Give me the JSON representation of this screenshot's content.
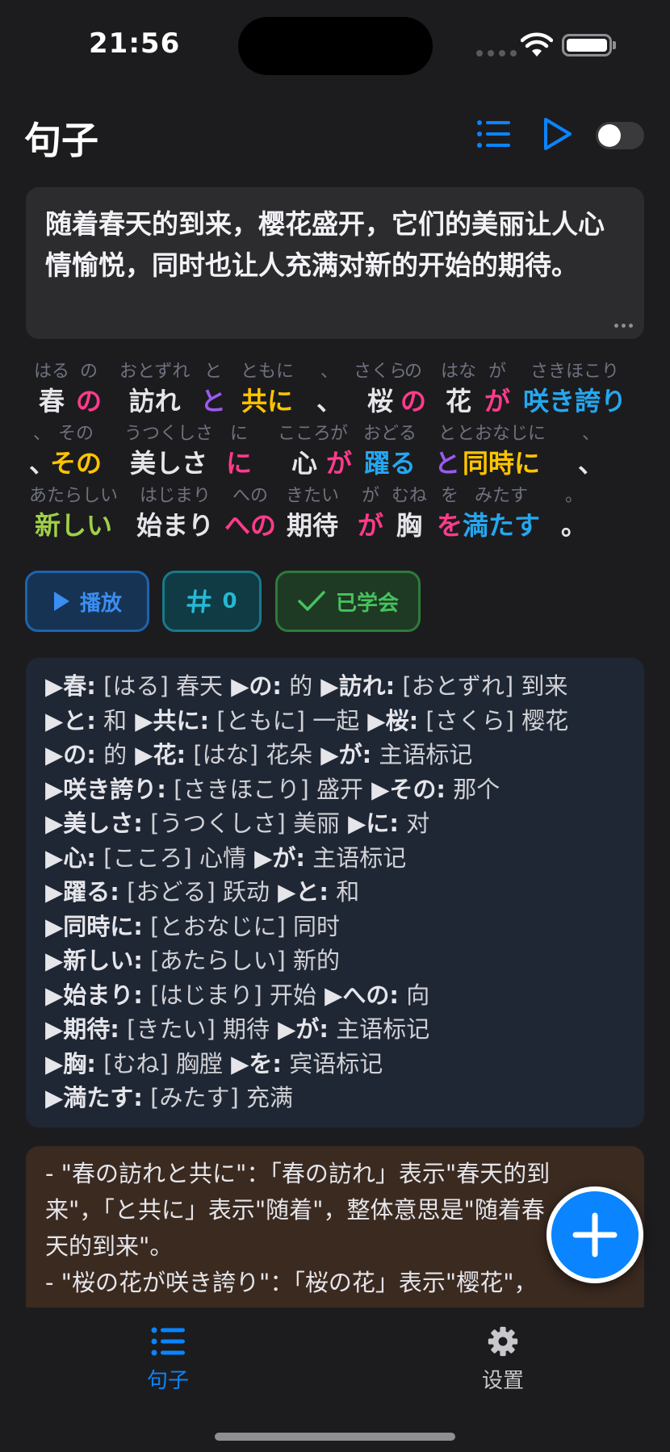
{
  "status_bar": {
    "time": "21:56"
  },
  "header": {
    "title": "句子"
  },
  "sentence": {
    "text": "随着春天的到来，樱花盛开，它们的美丽让人心情愉悦，同时也让人充满对新的开始的期待。"
  },
  "colors": {
    "accent": "#0a84ff",
    "particle": "#ff3b8b",
    "grammar": "#9b59f0",
    "adverb": "#ffc400",
    "verb": "#25a7f0",
    "adjective": "#9fd04a",
    "default": "#e5e5ea",
    "punct": "#e5e5ea"
  },
  "furigana": {
    "rows": [
      [
        {
          "r": "はる",
          "t": "春",
          "c": "default"
        },
        {
          "r": "の",
          "t": "の",
          "c": "particle"
        },
        {
          "r": "おとずれ",
          "t": "訪れ",
          "c": "default"
        },
        {
          "r": "と",
          "t": "と",
          "c": "grammar"
        },
        {
          "r": "ともに",
          "t": "共に",
          "c": "adverb"
        },
        {
          "r": "、",
          "t": "、",
          "c": "punct"
        },
        {
          "r": "さくら",
          "t": "桜",
          "c": "default"
        },
        {
          "r": "の",
          "t": "の",
          "c": "particle"
        },
        {
          "r": "はな",
          "t": "花",
          "c": "default"
        },
        {
          "r": "が",
          "t": "が",
          "c": "particle"
        },
        {
          "r": "さきほこり",
          "t": "咲き誇り",
          "c": "verb"
        }
      ],
      [
        {
          "r": "、",
          "t": "、",
          "c": "punct"
        },
        {
          "r": "その",
          "t": "その",
          "c": "adverb"
        },
        {
          "r": "うつくしさ",
          "t": "美しさ",
          "c": "default"
        },
        {
          "r": "に",
          "t": "に",
          "c": "particle"
        },
        {
          "r": "こころ",
          "t": "心",
          "c": "default"
        },
        {
          "r": "が",
          "t": "が",
          "c": "particle"
        },
        {
          "r": "おどる",
          "t": "躍る",
          "c": "verb"
        },
        {
          "r": "と",
          "t": "と",
          "c": "grammar"
        },
        {
          "r": "とおなじに",
          "t": "同時に",
          "c": "adverb"
        },
        {
          "r": "、",
          "t": "、",
          "c": "punct"
        }
      ],
      [
        {
          "r": "あたらしい",
          "t": "新しい",
          "c": "adjective"
        },
        {
          "r": "はじまり",
          "t": "始まり",
          "c": "default"
        },
        {
          "r": "への",
          "t": "への",
          "c": "particle"
        },
        {
          "r": "きたい",
          "t": "期待",
          "c": "default"
        },
        {
          "r": "が",
          "t": "が",
          "c": "particle"
        },
        {
          "r": "むね",
          "t": "胸",
          "c": "default"
        },
        {
          "r": "を",
          "t": "を",
          "c": "particle"
        },
        {
          "r": "みたす",
          "t": "満たす",
          "c": "verb"
        },
        {
          "r": "。",
          "t": "。",
          "c": "punct"
        }
      ]
    ]
  },
  "actions": {
    "play_label": "播放",
    "count_label": "0",
    "learned_label": "已学会"
  },
  "vocab": [
    [
      {
        "w": "春",
        "d": "[はる] 春天"
      },
      {
        "w": "の",
        "d": "的"
      },
      {
        "w": "訪れ",
        "d": "[おとずれ] 到来"
      }
    ],
    [
      {
        "w": "と",
        "d": "和"
      },
      {
        "w": "共に",
        "d": "[ともに] 一起"
      },
      {
        "w": "桜",
        "d": "[さくら] 樱花"
      }
    ],
    [
      {
        "w": "の",
        "d": "的"
      },
      {
        "w": "花",
        "d": "[はな] 花朵"
      },
      {
        "w": "が",
        "d": "主语标记"
      }
    ],
    [
      {
        "w": "咲き誇り",
        "d": "[さきほこり] 盛开"
      },
      {
        "w": "その",
        "d": "那个"
      }
    ],
    [
      {
        "w": "美しさ",
        "d": "[うつくしさ] 美丽"
      },
      {
        "w": "に",
        "d": "对"
      }
    ],
    [
      {
        "w": "心",
        "d": "[こころ] 心情"
      },
      {
        "w": "が",
        "d": "主语标记"
      }
    ],
    [
      {
        "w": "躍る",
        "d": "[おどる] 跃动"
      },
      {
        "w": "と",
        "d": "和"
      }
    ],
    [
      {
        "w": "同時に",
        "d": "[とおなじに] 同时"
      }
    ],
    [
      {
        "w": "新しい",
        "d": "[あたらしい] 新的"
      }
    ],
    [
      {
        "w": "始まり",
        "d": "[はじまり] 开始"
      },
      {
        "w": "への",
        "d": "向"
      }
    ],
    [
      {
        "w": "期待",
        "d": "[きたい] 期待"
      },
      {
        "w": "が",
        "d": "主语标记"
      }
    ],
    [
      {
        "w": "胸",
        "d": "[むね] 胸膛"
      },
      {
        "w": "を",
        "d": "宾语标记"
      }
    ],
    [
      {
        "w": "満たす",
        "d": "[みたす] 充满"
      }
    ]
  ],
  "explanation": {
    "lines": [
      "- \"春の訪れと共に\"：「春の訪れ」表示\"春天的到",
      "来\"，「と共に」表示\"随着\"，整体意思是\"随着春",
      "天的到来\"。",
      "- \"桜の花が咲き誇り\"：「桜の花」表示\"樱花\"，"
    ]
  },
  "tabbar": {
    "sentences_label": "句子",
    "settings_label": "设置"
  },
  "icons": {
    "header_list": "list-icon",
    "header_play": "play-icon",
    "fab": "plus-icon",
    "tab_sentences": "list-icon",
    "tab_settings": "gear-icon"
  }
}
